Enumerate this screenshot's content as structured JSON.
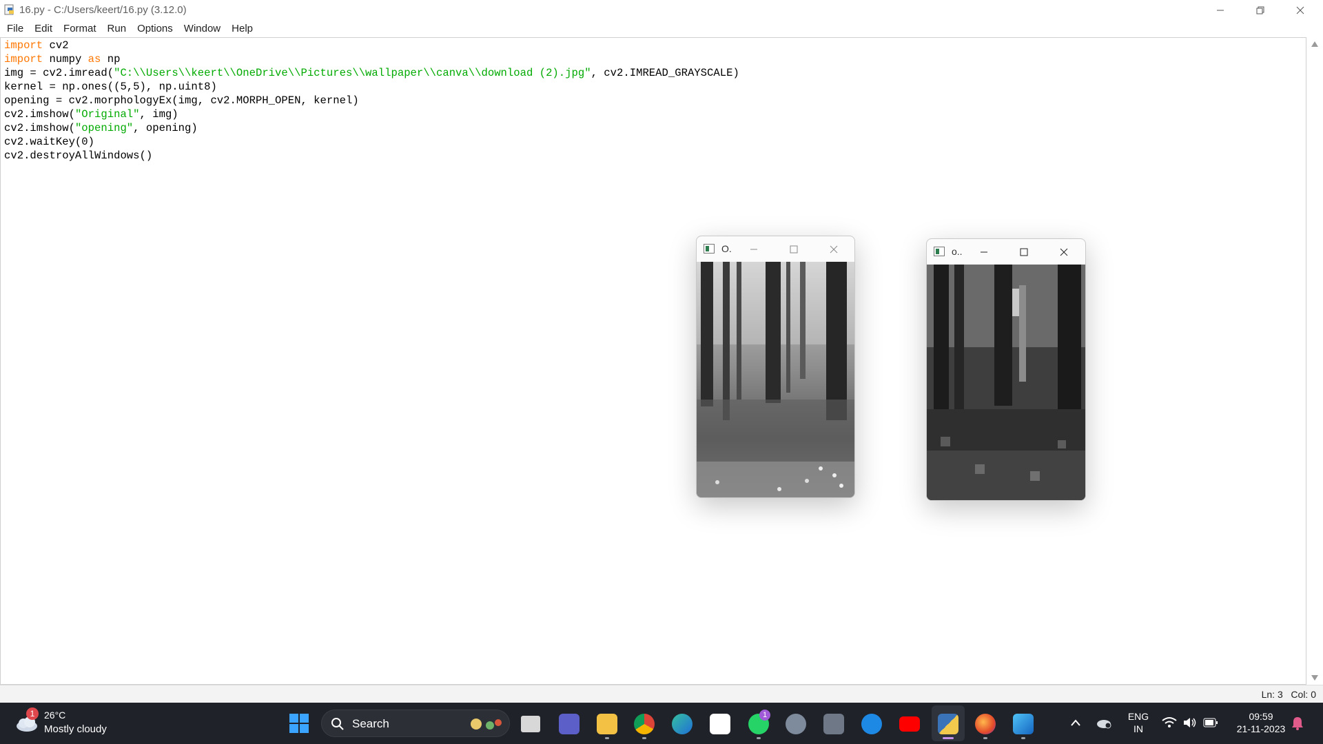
{
  "window": {
    "title": "16.py - C:/Users/keert/16.py (3.12.0)"
  },
  "menu": [
    "File",
    "Edit",
    "Format",
    "Run",
    "Options",
    "Window",
    "Help"
  ],
  "code": [
    [
      {
        "t": "import",
        "c": "kw"
      },
      {
        "t": " cv2"
      }
    ],
    [
      {
        "t": "import",
        "c": "kw"
      },
      {
        "t": " numpy "
      },
      {
        "t": "as",
        "c": "kw"
      },
      {
        "t": " np"
      }
    ],
    [
      {
        "t": "img = cv2.imread("
      },
      {
        "t": "\"C:\\\\Users\\\\keert\\\\OneDrive\\\\Pictures\\\\wallpaper\\\\canva\\\\download (2).jpg\"",
        "c": "str"
      },
      {
        "t": ", cv2.IMREAD_GRAYSCALE)"
      }
    ],
    [
      {
        "t": "kernel = np.ones((5,5), np.uint8)"
      }
    ],
    [
      {
        "t": "opening = cv2.morphologyEx(img, cv2.MORPH_OPEN, kernel)"
      }
    ],
    [
      {
        "t": "cv2.imshow("
      },
      {
        "t": "\"Original\"",
        "c": "str"
      },
      {
        "t": ", img)"
      }
    ],
    [
      {
        "t": "cv2.imshow("
      },
      {
        "t": "\"opening\"",
        "c": "str"
      },
      {
        "t": ", opening)"
      }
    ],
    [
      {
        "t": "cv2.waitKey(0)"
      }
    ],
    [
      {
        "t": "cv2.destroyAllWindows()"
      }
    ]
  ],
  "status": {
    "line": "Ln: 3",
    "col": "Col: 0"
  },
  "image_windows": [
    {
      "title": "O.",
      "name": "original-window"
    },
    {
      "title": "o..",
      "name": "opening-window"
    }
  ],
  "taskbar": {
    "weather_temp": "26°C",
    "weather_desc": "Mostly cloudy",
    "weather_badge": "1",
    "search_label": "Search",
    "whatsapp_badge": "1",
    "lang_top": "ENG",
    "lang_bottom": "IN",
    "time": "09:59",
    "date": "21-11-2023",
    "icons": [
      "task-view-icon",
      "teams-icon",
      "file-explorer-icon",
      "chrome-icon",
      "edge-icon",
      "microsoft-store-icon",
      "whatsapp-icon",
      "settings-icon",
      "camera-icon",
      "help-icon",
      "youtube-icon",
      "idle-python-icon",
      "firefox-icon",
      "photos-icon"
    ]
  },
  "colors": {
    "keyword": "#ff7700",
    "string": "#00aa00",
    "taskbar": "#1f2229"
  }
}
